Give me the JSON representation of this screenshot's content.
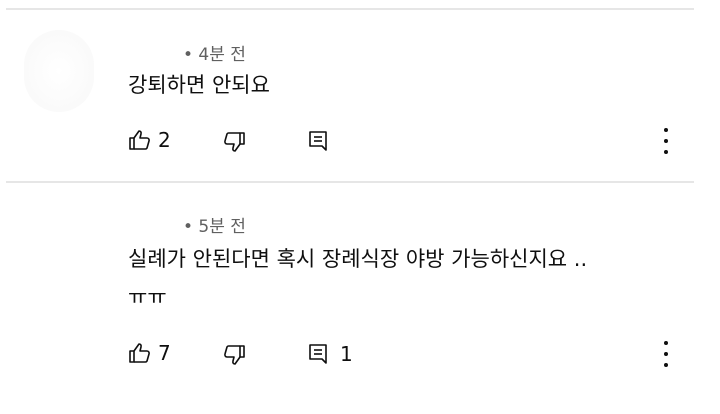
{
  "comments": [
    {
      "time": "• 4분 전",
      "text_lines": [
        "강퇴하면 안되요"
      ],
      "like_count": "2",
      "reply_count": ""
    },
    {
      "time": "• 5분 전",
      "text_lines": [
        "실례가 안된다면 혹시 장례식장 야방 가능하신지요 ..",
        "ㅠㅠ"
      ],
      "like_count": "7",
      "reply_count": "1"
    }
  ],
  "icons": {
    "like": "thumb-up-icon",
    "dislike": "thumb-down-icon",
    "reply": "reply-icon",
    "more": "more-vertical-icon"
  }
}
